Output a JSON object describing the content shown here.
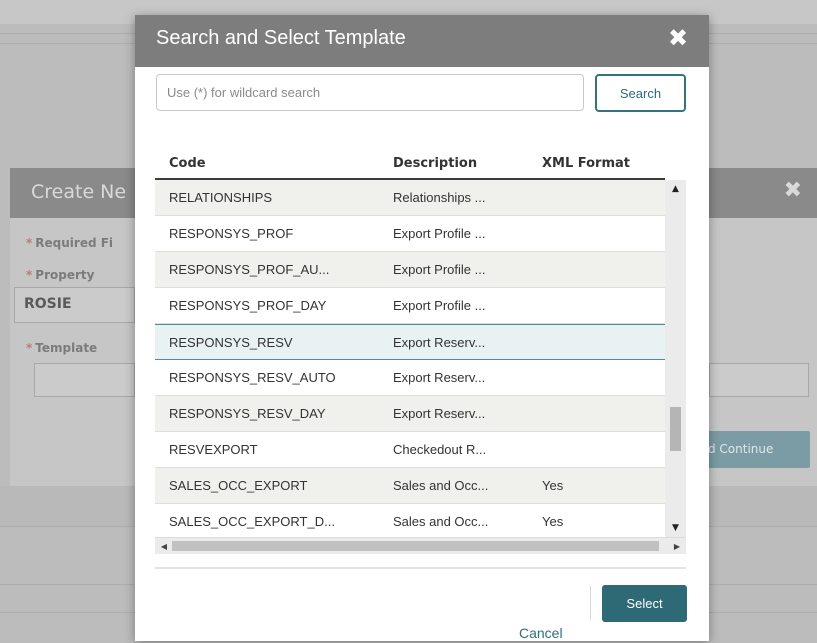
{
  "background": {
    "dialog_title": "Create Ne",
    "required_label": "Required Fi",
    "property_label": "Property",
    "property_value": "ROSIE",
    "template_label": "Template",
    "continue_label": "d Continue",
    "close_glyph": "✖"
  },
  "modal": {
    "title": "Search and Select Template",
    "close_glyph": "✖",
    "search": {
      "placeholder": "Use (*) for wildcard search",
      "value": "",
      "button_label": "Search"
    },
    "table": {
      "columns": [
        "Code",
        "Description",
        "XML Format"
      ],
      "rows": [
        {
          "code": "RELATIONSHIPS",
          "description": "Relationships ...",
          "xml": ""
        },
        {
          "code": "RESPONSYS_PROF",
          "description": "Export Profile ...",
          "xml": ""
        },
        {
          "code": "RESPONSYS_PROF_AU...",
          "description": "Export Profile ...",
          "xml": ""
        },
        {
          "code": "RESPONSYS_PROF_DAY",
          "description": "Export Profile ...",
          "xml": ""
        },
        {
          "code": "RESPONSYS_RESV",
          "description": "Export Reserv...",
          "xml": ""
        },
        {
          "code": "RESPONSYS_RESV_AUTO",
          "description": "Export Reserv...",
          "xml": ""
        },
        {
          "code": "RESPONSYS_RESV_DAY",
          "description": "Export Reserv...",
          "xml": ""
        },
        {
          "code": "RESVEXPORT",
          "description": "Checkedout R...",
          "xml": ""
        },
        {
          "code": "SALES_OCC_EXPORT",
          "description": "Sales and Occ...",
          "xml": "Yes"
        },
        {
          "code": "SALES_OCC_EXPORT_D...",
          "description": "Sales and Occ...",
          "xml": "Yes"
        }
      ],
      "selected_row_index": 4
    },
    "footer": {
      "cancel_label": "Cancel",
      "select_label": "Select"
    }
  }
}
